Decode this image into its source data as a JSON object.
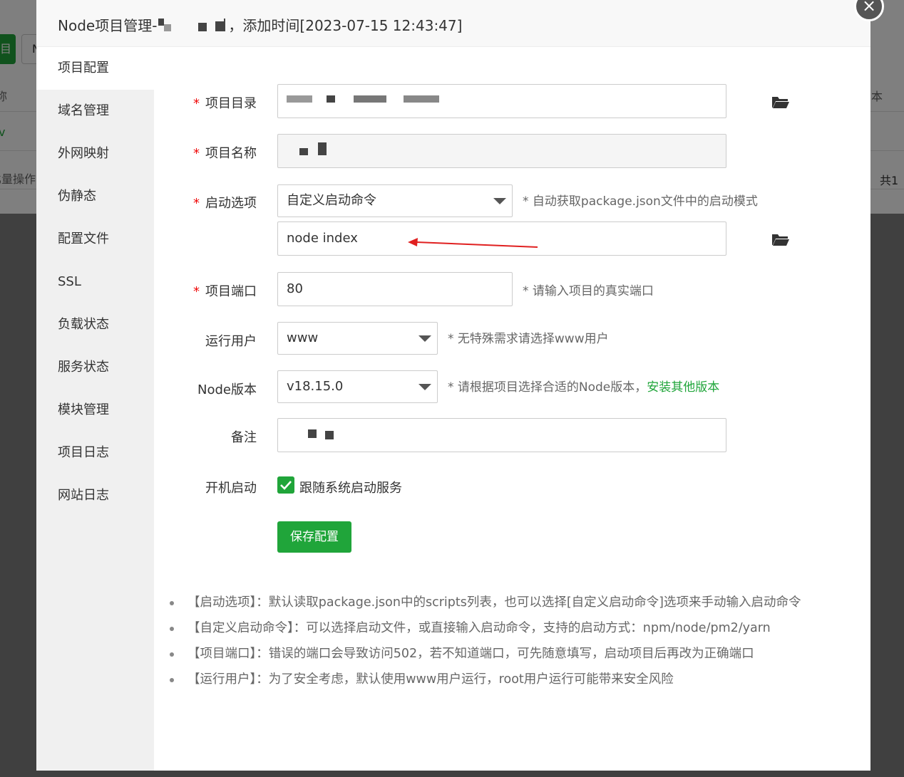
{
  "background": {
    "button_green_label": "目",
    "button_gray_label": "N",
    "row1_left": "称",
    "row1_right": "本",
    "row2_left": "v",
    "row3_left": "比量操作",
    "row3_right": "共1"
  },
  "dialog": {
    "title_prefix": "Node项目管理-",
    "title_suffix": "，添加时间[2023-07-15 12:43:47]",
    "close_label": "×"
  },
  "sidebar": {
    "items": [
      {
        "label": "项目配置",
        "active": true
      },
      {
        "label": "域名管理"
      },
      {
        "label": "外网映射"
      },
      {
        "label": "伪静态"
      },
      {
        "label": "配置文件"
      },
      {
        "label": "SSL"
      },
      {
        "label": "负载状态"
      },
      {
        "label": "服务状态"
      },
      {
        "label": "模块管理"
      },
      {
        "label": "项目日志"
      },
      {
        "label": "网站日志"
      }
    ]
  },
  "form": {
    "project_dir": {
      "label": "项目目录",
      "required": "*"
    },
    "project_name": {
      "label": "项目名称",
      "required": "*"
    },
    "start_option": {
      "label": "启动选项",
      "required": "*",
      "selected": "自定义启动命令",
      "hint": "* 自动获取package.json文件中的启动模式"
    },
    "start_command": {
      "value": "node index"
    },
    "project_port": {
      "label": "项目端口",
      "required": "*",
      "value": "80",
      "hint": "* 请输入项目的真实端口"
    },
    "run_user": {
      "label": "运行用户",
      "selected": "www",
      "hint": "* 无特殊需求请选择www用户"
    },
    "node_version": {
      "label": "Node版本",
      "selected": "v18.15.0",
      "hint": "* 请根据项目选择合适的Node版本，",
      "link": "安装其他版本"
    },
    "remark": {
      "label": "备注"
    },
    "autostart": {
      "label": "开机启动",
      "checkbox_label": "跟随系统启动服务",
      "checked": true
    },
    "save_button": "保存配置"
  },
  "notes": [
    "【启动选项】：默认读取package.json中的scripts列表，也可以选择[自定义启动命令]选项来手动输入启动命令",
    "【自定义启动命令】：可以选择启动文件，或直接输入启动命令，支持的启动方式：npm/node/pm2/yarn",
    "【项目端口】：错误的端口会导致访问502，若不知道端口，可先随意填写，启动项目后再改为正确端口",
    "【运行用户】：为了安全考虑，默认使用www用户运行，root用户运行可能带来安全风险"
  ],
  "colors": {
    "accent": "#20a53a",
    "required": "#ef0808",
    "arrow": "#e02020"
  }
}
